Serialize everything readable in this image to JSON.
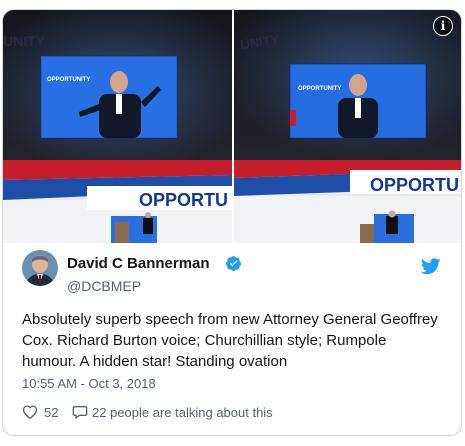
{
  "media": {
    "left_screen_text": "OPPORTUNITY",
    "right_screen_text": "OPPORTUNITY",
    "left_banner_text": "OPPORTU",
    "right_banner_text": "OPPORTU",
    "left_top_watermark": "UNITY",
    "right_top_watermark": "UNITY",
    "info_icon": "i"
  },
  "tweet": {
    "author_name": "David C Bannerman",
    "handle": "@DCBMEP",
    "text": "Absolutely superb speech from new Attorney General Geoffrey Cox. Richard Burton voice; Churchillian style; Rumpole humour. A hidden star! Standing ovation",
    "timestamp": "10:55 AM - Oct 3, 2018",
    "likes": "52",
    "conversation": "22 people are talking about this"
  },
  "colors": {
    "verified_blue": "#1d9bf0",
    "twitter_blue": "#1da1f2",
    "text_primary": "#14171a",
    "text_secondary": "#536471"
  },
  "icons": {
    "info": "info-icon",
    "verified": "verified-badge-icon",
    "twitter": "twitter-bird-icon",
    "like": "heart-icon",
    "reply": "speech-bubble-icon"
  }
}
